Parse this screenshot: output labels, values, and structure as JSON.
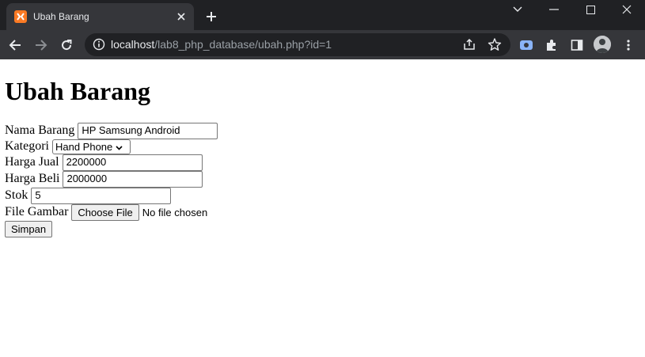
{
  "browser": {
    "tab_title": "Ubah Barang",
    "url_host": "localhost",
    "url_path": "/lab8_php_database/ubah.php?id=1",
    "frame_color": "#202124",
    "toolbar_color": "#35363a",
    "favicon_color": "#fb7a24"
  },
  "page": {
    "heading": "Ubah Barang",
    "fields": {
      "nama": {
        "label": "Nama Barang",
        "value": "HP Samsung Android"
      },
      "kategori": {
        "label": "Kategori",
        "value": "Hand Phone"
      },
      "harga_jual": {
        "label": "Harga Jual",
        "value": "2200000"
      },
      "harga_beli": {
        "label": "Harga Beli",
        "value": "2000000"
      },
      "stok": {
        "label": "Stok",
        "value": "5"
      },
      "gambar": {
        "label": "File Gambar",
        "button": "Choose File",
        "status": "No file chosen"
      }
    },
    "submit_label": "Simpan"
  }
}
